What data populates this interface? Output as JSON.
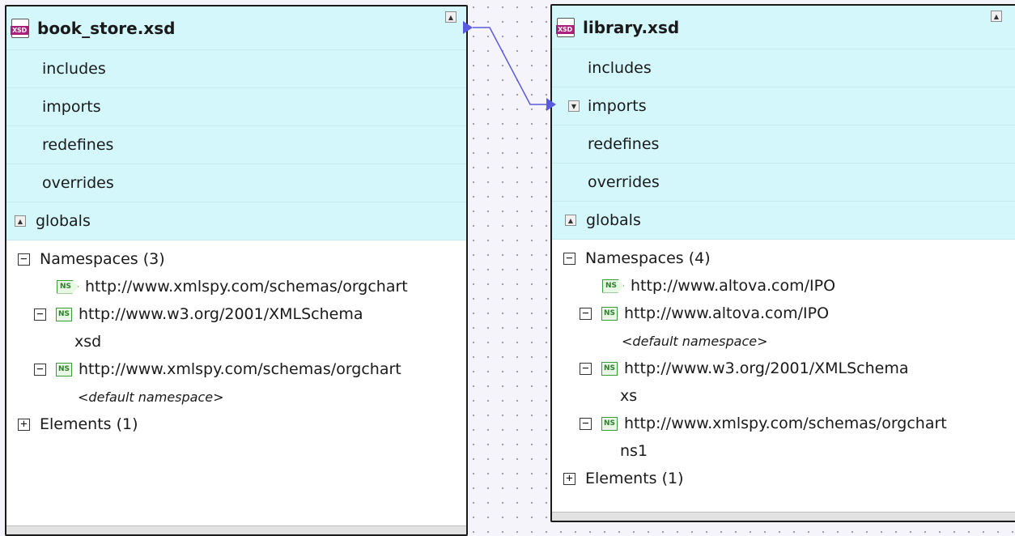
{
  "left_schema": {
    "title": "book_store.xsd",
    "sections": [
      "includes",
      "imports",
      "redefines",
      "overrides"
    ],
    "globals_label": "globals",
    "namespaces_header": "Namespaces (3)",
    "namespaces": [
      {
        "uri": "http://www.xmlspy.com/schemas/orgchart",
        "prefix": null
      },
      {
        "uri": "http://www.w3.org/2001/XMLSchema",
        "prefix": "xsd"
      },
      {
        "uri": "http://www.xmlspy.com/schemas/orgchart",
        "prefix": "<default namespace>"
      }
    ],
    "elements_header": "Elements (1)"
  },
  "right_schema": {
    "title": "library.xsd",
    "sections": [
      "includes",
      "imports",
      "redefines",
      "overrides"
    ],
    "globals_label": "globals",
    "namespaces_header": "Namespaces (4)",
    "namespaces": [
      {
        "uri": "http://www.altova.com/IPO",
        "prefix": null
      },
      {
        "uri": "http://www.altova.com/IPO",
        "prefix": "<default namespace>"
      },
      {
        "uri": "http://www.w3.org/2001/XMLSchema",
        "prefix": "xs"
      },
      {
        "uri": "http://www.xmlspy.com/schemas/orgchart",
        "prefix": "ns1"
      }
    ],
    "elements_header": "Elements (1)"
  },
  "icons": {
    "file_badge": "XSD",
    "namespace_badge": "NS"
  },
  "colors": {
    "band": "#d4f7fb",
    "xsd_badge": "#a8207a",
    "ns_green": "#3c9a3c",
    "connector": "#5a5ae0"
  }
}
